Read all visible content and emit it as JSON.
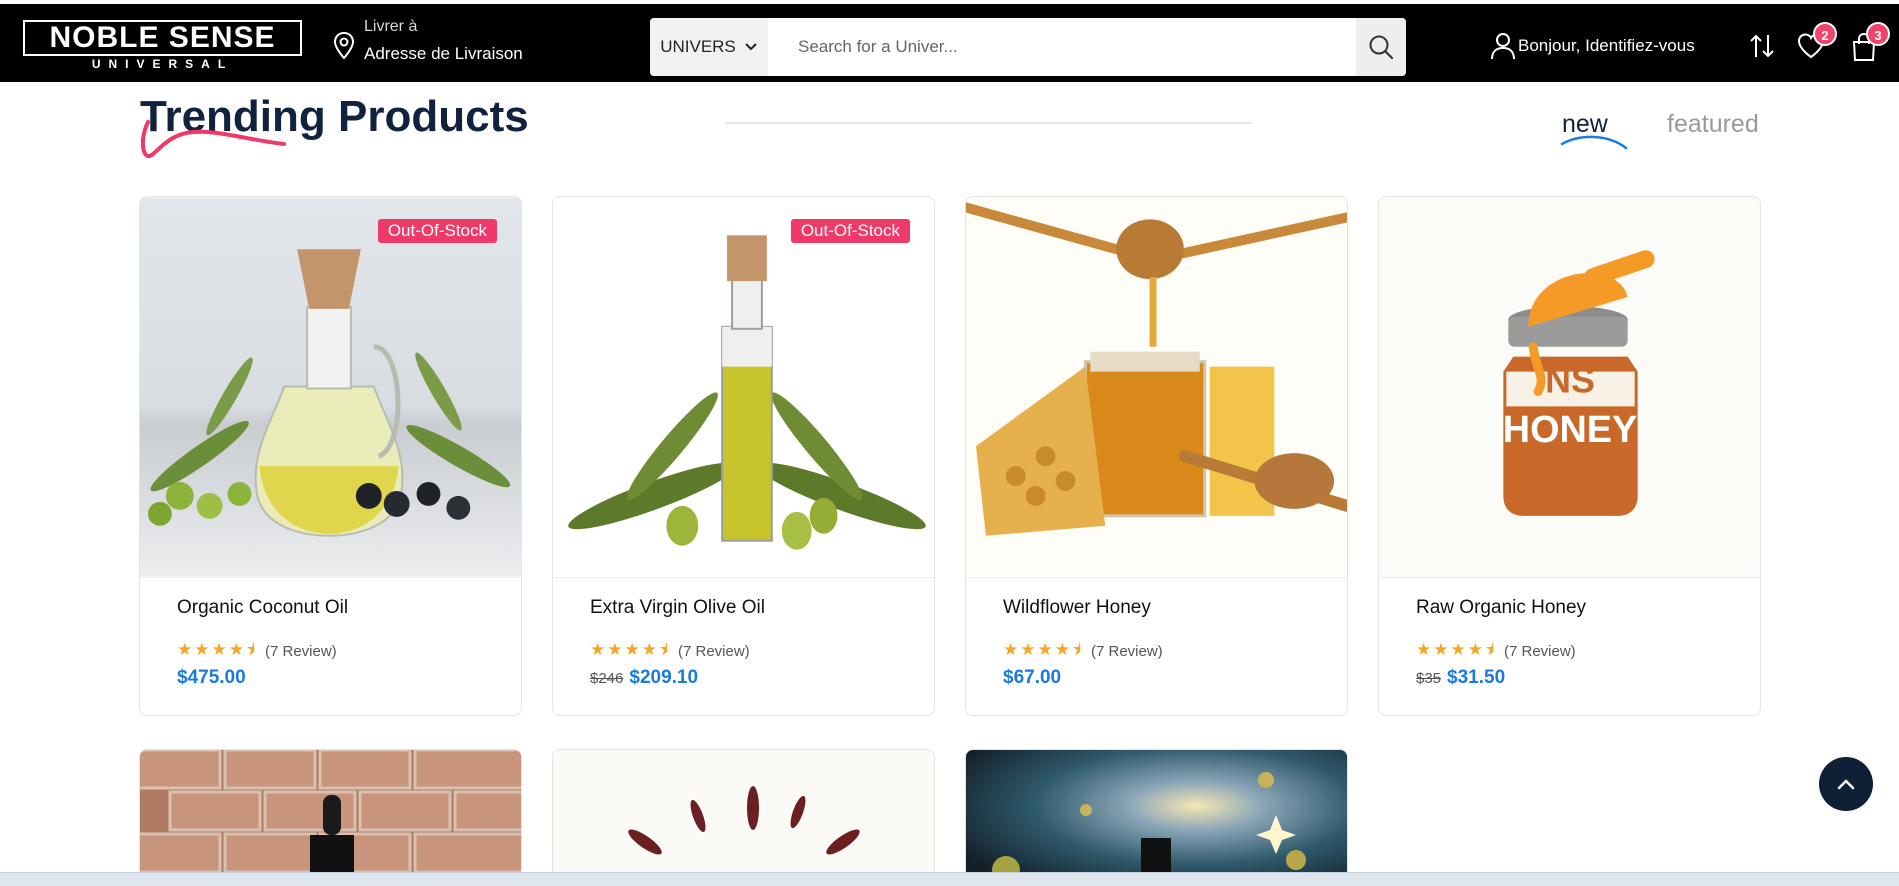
{
  "header": {
    "logo": {
      "main": "NOBLE SENSE",
      "sub": "UNIVERSAL"
    },
    "deliver": {
      "line1": "Livrer à",
      "line2": "Adresse de Livraison"
    },
    "search": {
      "category": "UNIVERS",
      "placeholder": "Search for a Univer..."
    },
    "account_label": "Bonjour, Identifiez-vous",
    "wishlist_count": "2",
    "cart_count": "3",
    "icons": [
      "pin-icon",
      "chevron-down-icon",
      "search-icon",
      "user-icon",
      "sort-icon",
      "heart-icon",
      "bag-icon"
    ]
  },
  "section": {
    "title": "Trending Products",
    "tabs": [
      {
        "label": "new",
        "active": true
      },
      {
        "label": "featured",
        "active": false
      }
    ]
  },
  "products": [
    {
      "name": "Organic Coconut Oil",
      "badge": "Out-Of-Stock",
      "rating": 4.5,
      "reviews": "(7 Review)",
      "old_price": "",
      "price": "$475.00"
    },
    {
      "name": "Extra Virgin Olive Oil",
      "badge": "Out-Of-Stock",
      "rating": 4.5,
      "reviews": "(7 Review)",
      "old_price": "$246",
      "price": "$209.10"
    },
    {
      "name": "Wildflower Honey",
      "badge": "",
      "rating": 4.5,
      "reviews": "(7 Review)",
      "old_price": "",
      "price": "$67.00"
    },
    {
      "name": "Raw Organic Honey",
      "badge": "",
      "rating": 4.5,
      "reviews": "(7 Review)",
      "old_price": "$35",
      "price": "$31.50"
    }
  ],
  "honey_jar_label": {
    "brand": "NS",
    "text": "HONEY"
  },
  "colors": {
    "header_bg": "#000000",
    "accent_pink": "#ee3969",
    "price_blue": "#1a7ae0",
    "title_navy": "#10223e",
    "star": "#f5a623"
  }
}
